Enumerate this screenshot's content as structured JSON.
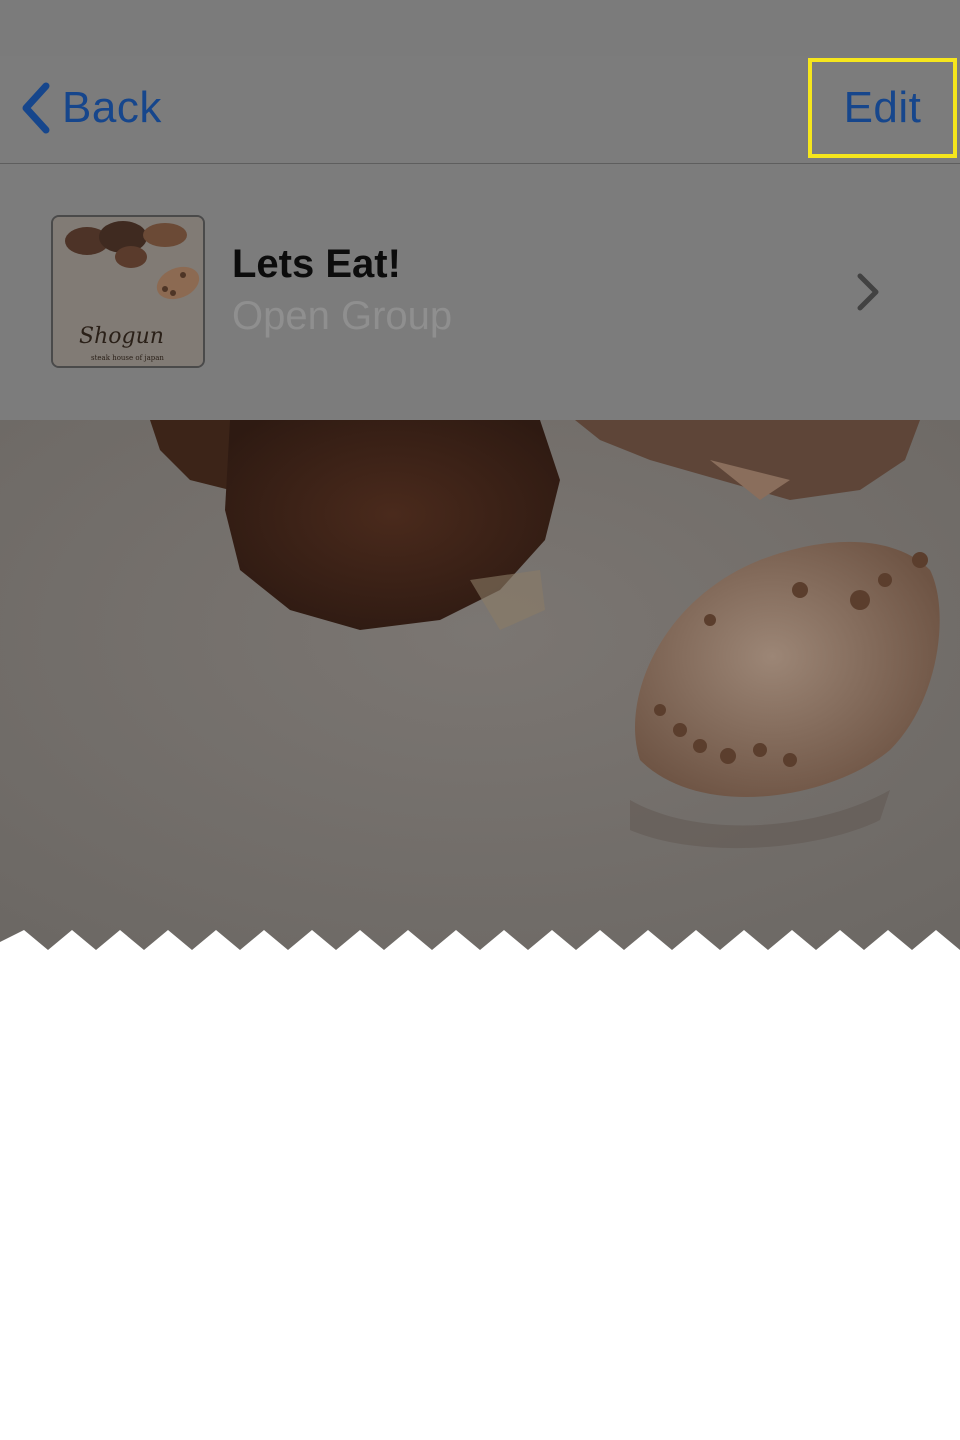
{
  "nav": {
    "back_label": "Back",
    "edit_label": "Edit"
  },
  "group": {
    "title": "Lets Eat!",
    "subtitle": "Open Group",
    "thumbnail": {
      "brand": "Shogun",
      "tagline": "steak house of japan"
    }
  },
  "icons": {
    "back": "chevron-left-icon",
    "disclosure": "chevron-right-icon"
  },
  "colors": {
    "overlay": "#7c7c7c",
    "link": "#16468c",
    "highlight": "#f6e61c"
  }
}
